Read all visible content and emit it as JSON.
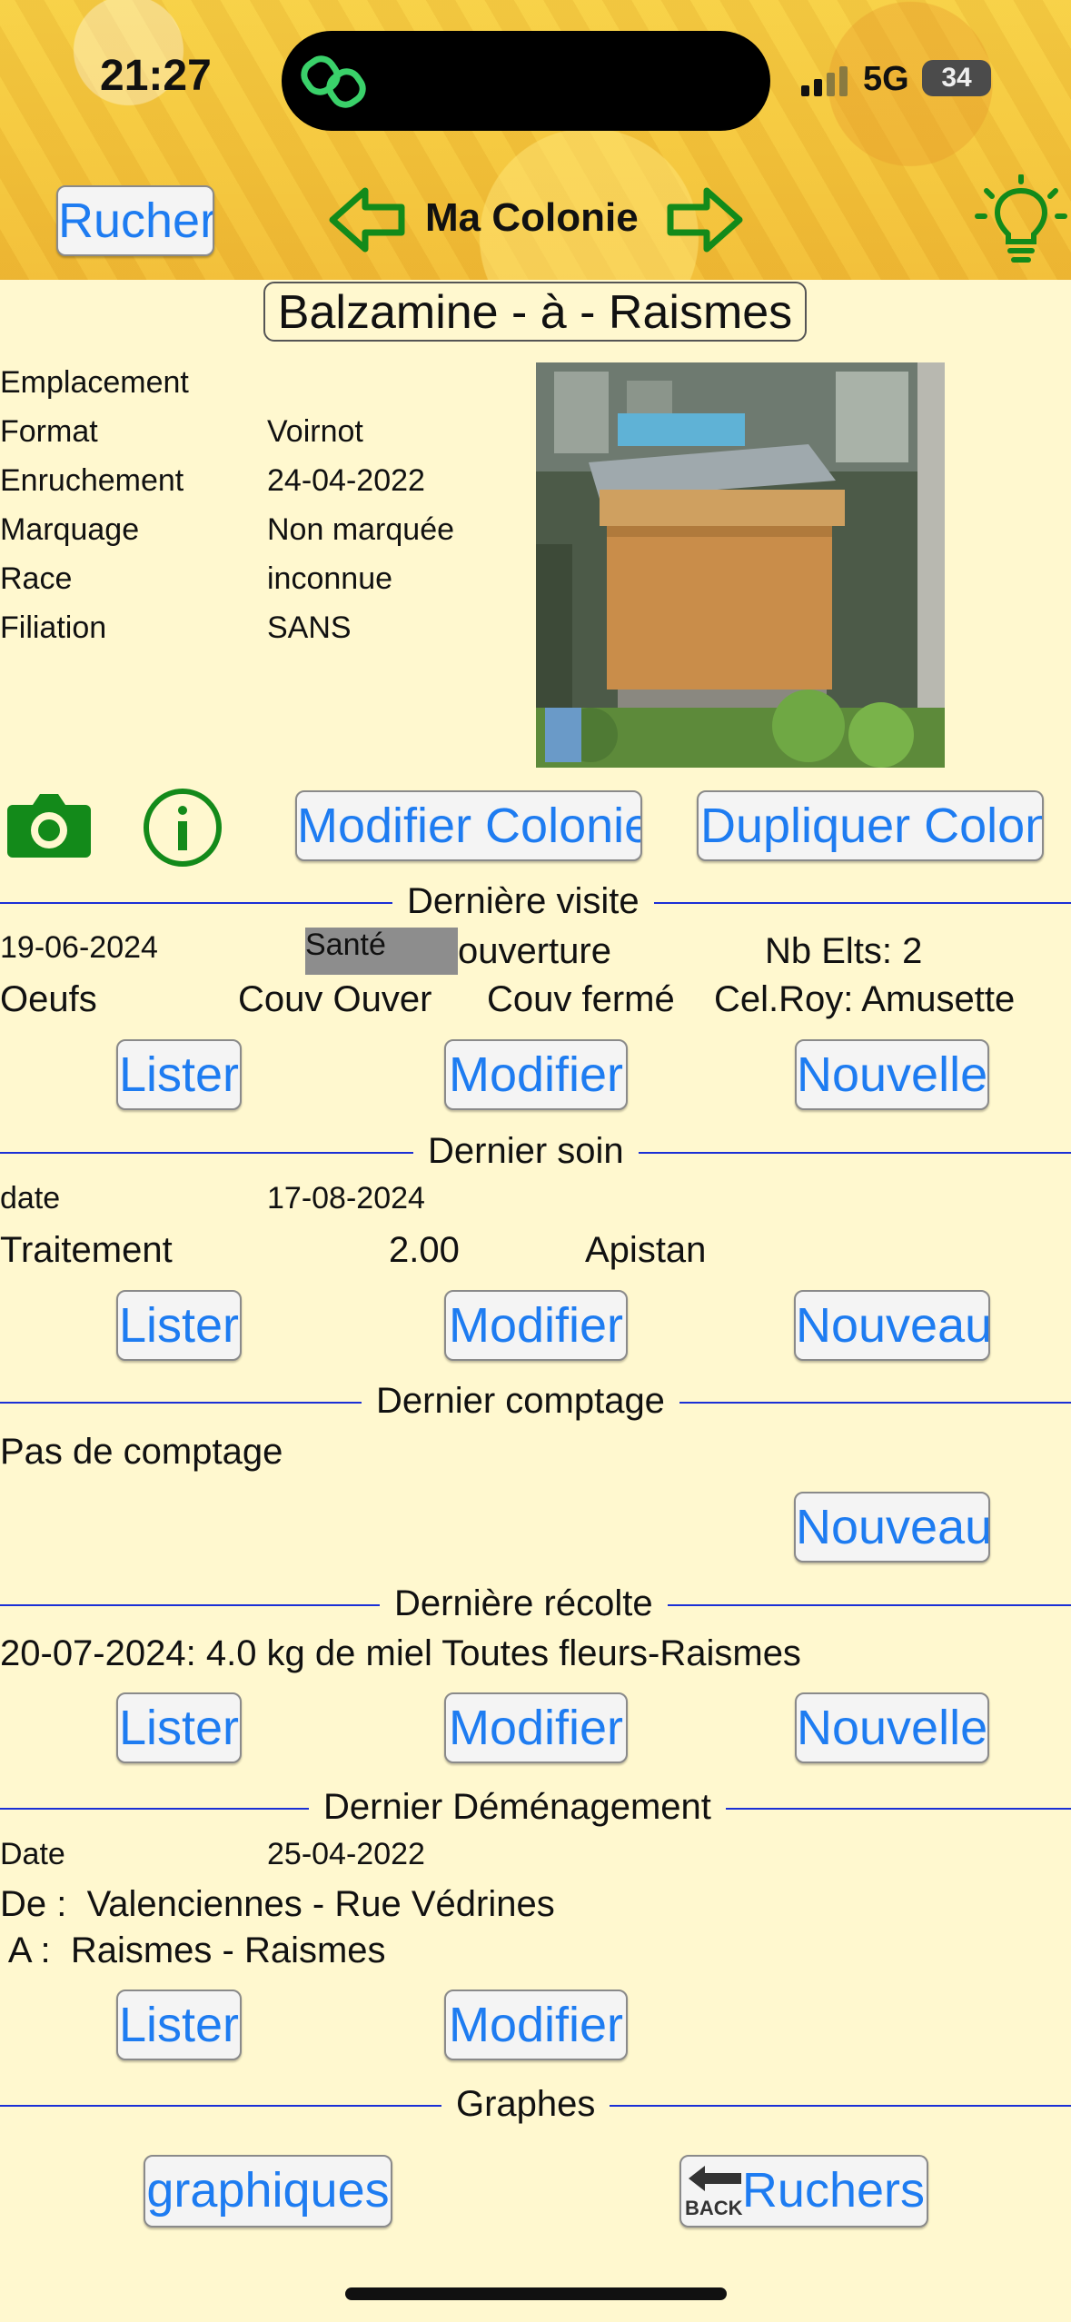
{
  "status_bar": {
    "time": "21:27",
    "network": "5G",
    "battery": "34"
  },
  "header": {
    "back_label": "Rucher",
    "title": "Ma Colonie"
  },
  "hive": {
    "name": "Balzamine - à - Raismes",
    "fields": [
      {
        "label": "Emplacement",
        "value": ""
      },
      {
        "label": "Format",
        "value": "Voirnot"
      },
      {
        "label": "Enruchement",
        "value": "24-04-2022"
      },
      {
        "label": "Marquage",
        "value": "Non marquée"
      },
      {
        "label": "Race",
        "value": "inconnue"
      },
      {
        "label": "Filiation",
        "value": "SANS"
      }
    ]
  },
  "actions": {
    "modify": "Modifier Colonie",
    "duplicate": "Dupliquer Colonie"
  },
  "last_visit": {
    "title": "Dernière visite",
    "date": "19-06-2024",
    "tag": "Santé",
    "type": "ouverture",
    "elements": "Nb Elts: 2",
    "eggs": "Oeufs",
    "open_brood": "Couv Ouver",
    "closed_brood": "Couv fermé",
    "royal_cells": "Cel.Roy: Amusette",
    "list": "Lister",
    "modify": "Modifier",
    "new": "Nouvelle"
  },
  "last_care": {
    "title": "Dernier soin",
    "date_label": "date",
    "date": "17-08-2024",
    "kind": "Traitement",
    "amount": "2.00",
    "product": "Apistan",
    "list": "Lister",
    "modify": "Modifier",
    "new": "Nouveau"
  },
  "last_count": {
    "title": "Dernier comptage",
    "empty": "Pas de comptage",
    "new": "Nouveau"
  },
  "last_harvest": {
    "title": "Dernière récolte",
    "summary": "20-07-2024: 4.0  kg de miel Toutes fleurs-Raismes",
    "list": "Lister",
    "modify": "Modifier",
    "new": "Nouvelle"
  },
  "last_move": {
    "title": "Dernier Déménagement",
    "date_label": "Date",
    "date": "25-04-2022",
    "from": "De :  Valenciennes - Rue Védrines",
    "to": " A :  Raismes - Raismes",
    "list": "Lister",
    "modify": "Modifier"
  },
  "graphs": {
    "title": "Graphes",
    "charts": "graphiques",
    "back_badge": "BACK",
    "back_label": "Ruchers"
  }
}
